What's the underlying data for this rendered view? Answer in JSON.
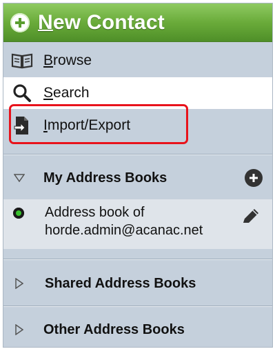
{
  "new_contact": {
    "label": "New Contact"
  },
  "nav": {
    "browse": {
      "label": "Browse",
      "icon": "book-icon"
    },
    "search": {
      "label": "Search",
      "icon": "search-icon"
    },
    "import_export": {
      "label": "Import/Export",
      "icon": "import-export-icon"
    }
  },
  "sections": {
    "my_address_books": {
      "title": "My Address Books",
      "books": [
        {
          "name": "Address book of horde.admin@acanac.net"
        }
      ]
    },
    "shared_address_books": {
      "title": "Shared Address Books"
    },
    "other_address_books": {
      "title": "Other Address Books"
    }
  },
  "colors": {
    "new_contact_green": "#6aab3a",
    "panel_bg": "#c5d0dc",
    "highlight_red": "#e8121b",
    "active_dot": "#39c12e"
  }
}
